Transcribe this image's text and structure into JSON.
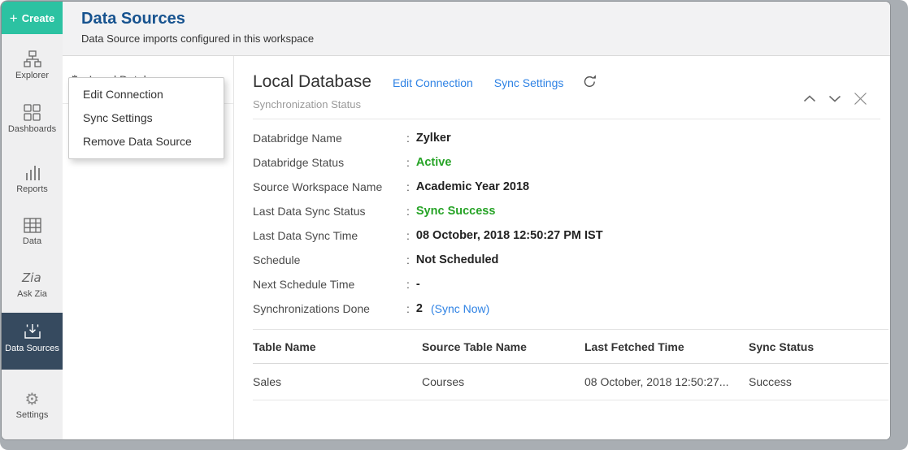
{
  "ui": {
    "colon": ":"
  },
  "colors": {
    "brand_green": "#2cc2a2",
    "sidebar_active_bg": "#364a5f",
    "title_blue": "#17538f",
    "link_blue": "#2e82e4",
    "success_green": "#26a326",
    "frame_gray": "#a9aeb3"
  },
  "icons": {
    "create": "plus",
    "explorer": "sitemap",
    "dashboards": "grid-squares",
    "reports": "bar-chart",
    "data": "table-grid",
    "ask_zia": "zia-script",
    "data_sources": "import-box",
    "settings": "gear",
    "source_item": "gear-with-caret",
    "refresh": "circular-arrow",
    "collapse": "chevron-up",
    "expand": "chevron-down",
    "close": "x-mark"
  },
  "sidebar": {
    "create_label": "Create",
    "items": [
      {
        "label": "Explorer"
      },
      {
        "label": "Dashboards"
      },
      {
        "label": "Reports"
      },
      {
        "label": "Data"
      },
      {
        "label": "Ask Zia"
      },
      {
        "label": "Data Sources",
        "active": true
      },
      {
        "label": "Settings"
      }
    ]
  },
  "header": {
    "title": "Data Sources",
    "subtitle": "Data Source imports configured in this workspace"
  },
  "source_panel": {
    "item_label": "Local Database",
    "menu_items": [
      {
        "label": "Edit Connection"
      },
      {
        "label": "Sync Settings"
      },
      {
        "label": "Remove Data Source"
      }
    ]
  },
  "main": {
    "title": "Local Database",
    "links": [
      {
        "label": "Edit Connection"
      },
      {
        "label": "Sync Settings"
      }
    ],
    "subtitle": "Synchronization Status",
    "details": [
      {
        "label": "Databridge Name",
        "value": "Zylker"
      },
      {
        "label": "Databridge Status",
        "value": "Active"
      },
      {
        "label": "Source Workspace Name",
        "value": "Academic Year 2018"
      },
      {
        "label": "Last Data Sync Status",
        "value": "Sync Success"
      },
      {
        "label": "Last Data Sync Time",
        "value": "08 October, 2018 12:50:27 PM IST"
      },
      {
        "label": "Schedule",
        "value": "Not Scheduled"
      },
      {
        "label": "Next Schedule Time",
        "value": "-"
      },
      {
        "label": "Synchronizations Done",
        "value": "2",
        "link": "(Sync Now)"
      }
    ],
    "table": {
      "columns": [
        "Table Name",
        "Source Table Name",
        "Last Fetched Time",
        "Sync Status"
      ],
      "rows": [
        [
          "Sales",
          "Courses",
          "08 October, 2018 12:50:27...",
          "Success"
        ]
      ]
    }
  }
}
